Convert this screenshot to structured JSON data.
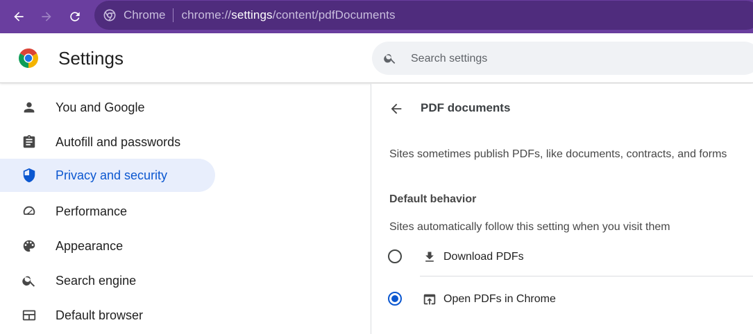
{
  "browser": {
    "omnibox_chip": "Chrome",
    "url_scheme": "chrome://",
    "url_host": "settings",
    "url_path": "/content/pdfDocuments"
  },
  "header": {
    "title": "Settings",
    "search_placeholder": "Search settings"
  },
  "sidebar": {
    "items": [
      {
        "label": "You and Google",
        "icon": "person-icon"
      },
      {
        "label": "Autofill and passwords",
        "icon": "clipboard-icon"
      },
      {
        "label": "Privacy and security",
        "icon": "shield-icon",
        "active": true
      },
      {
        "label": "Performance",
        "icon": "speedometer-icon"
      },
      {
        "label": "Appearance",
        "icon": "palette-icon"
      },
      {
        "label": "Search engine",
        "icon": "search-icon"
      },
      {
        "label": "Default browser",
        "icon": "browser-window-icon"
      }
    ]
  },
  "main": {
    "title": "PDF documents",
    "description": "Sites sometimes publish PDFs, like documents, contracts, and forms",
    "section_title": "Default behavior",
    "section_subtitle": "Sites automatically follow this setting when you visit them",
    "options": [
      {
        "label": "Download PDFs",
        "icon": "download-icon",
        "checked": false
      },
      {
        "label": "Open PDFs in Chrome",
        "icon": "open-in-browser-icon",
        "checked": true
      }
    ]
  },
  "colors": {
    "toolbar": "#6a3e9f",
    "accent": "#0b57d0",
    "active_nav_bg": "#e8eefc"
  }
}
